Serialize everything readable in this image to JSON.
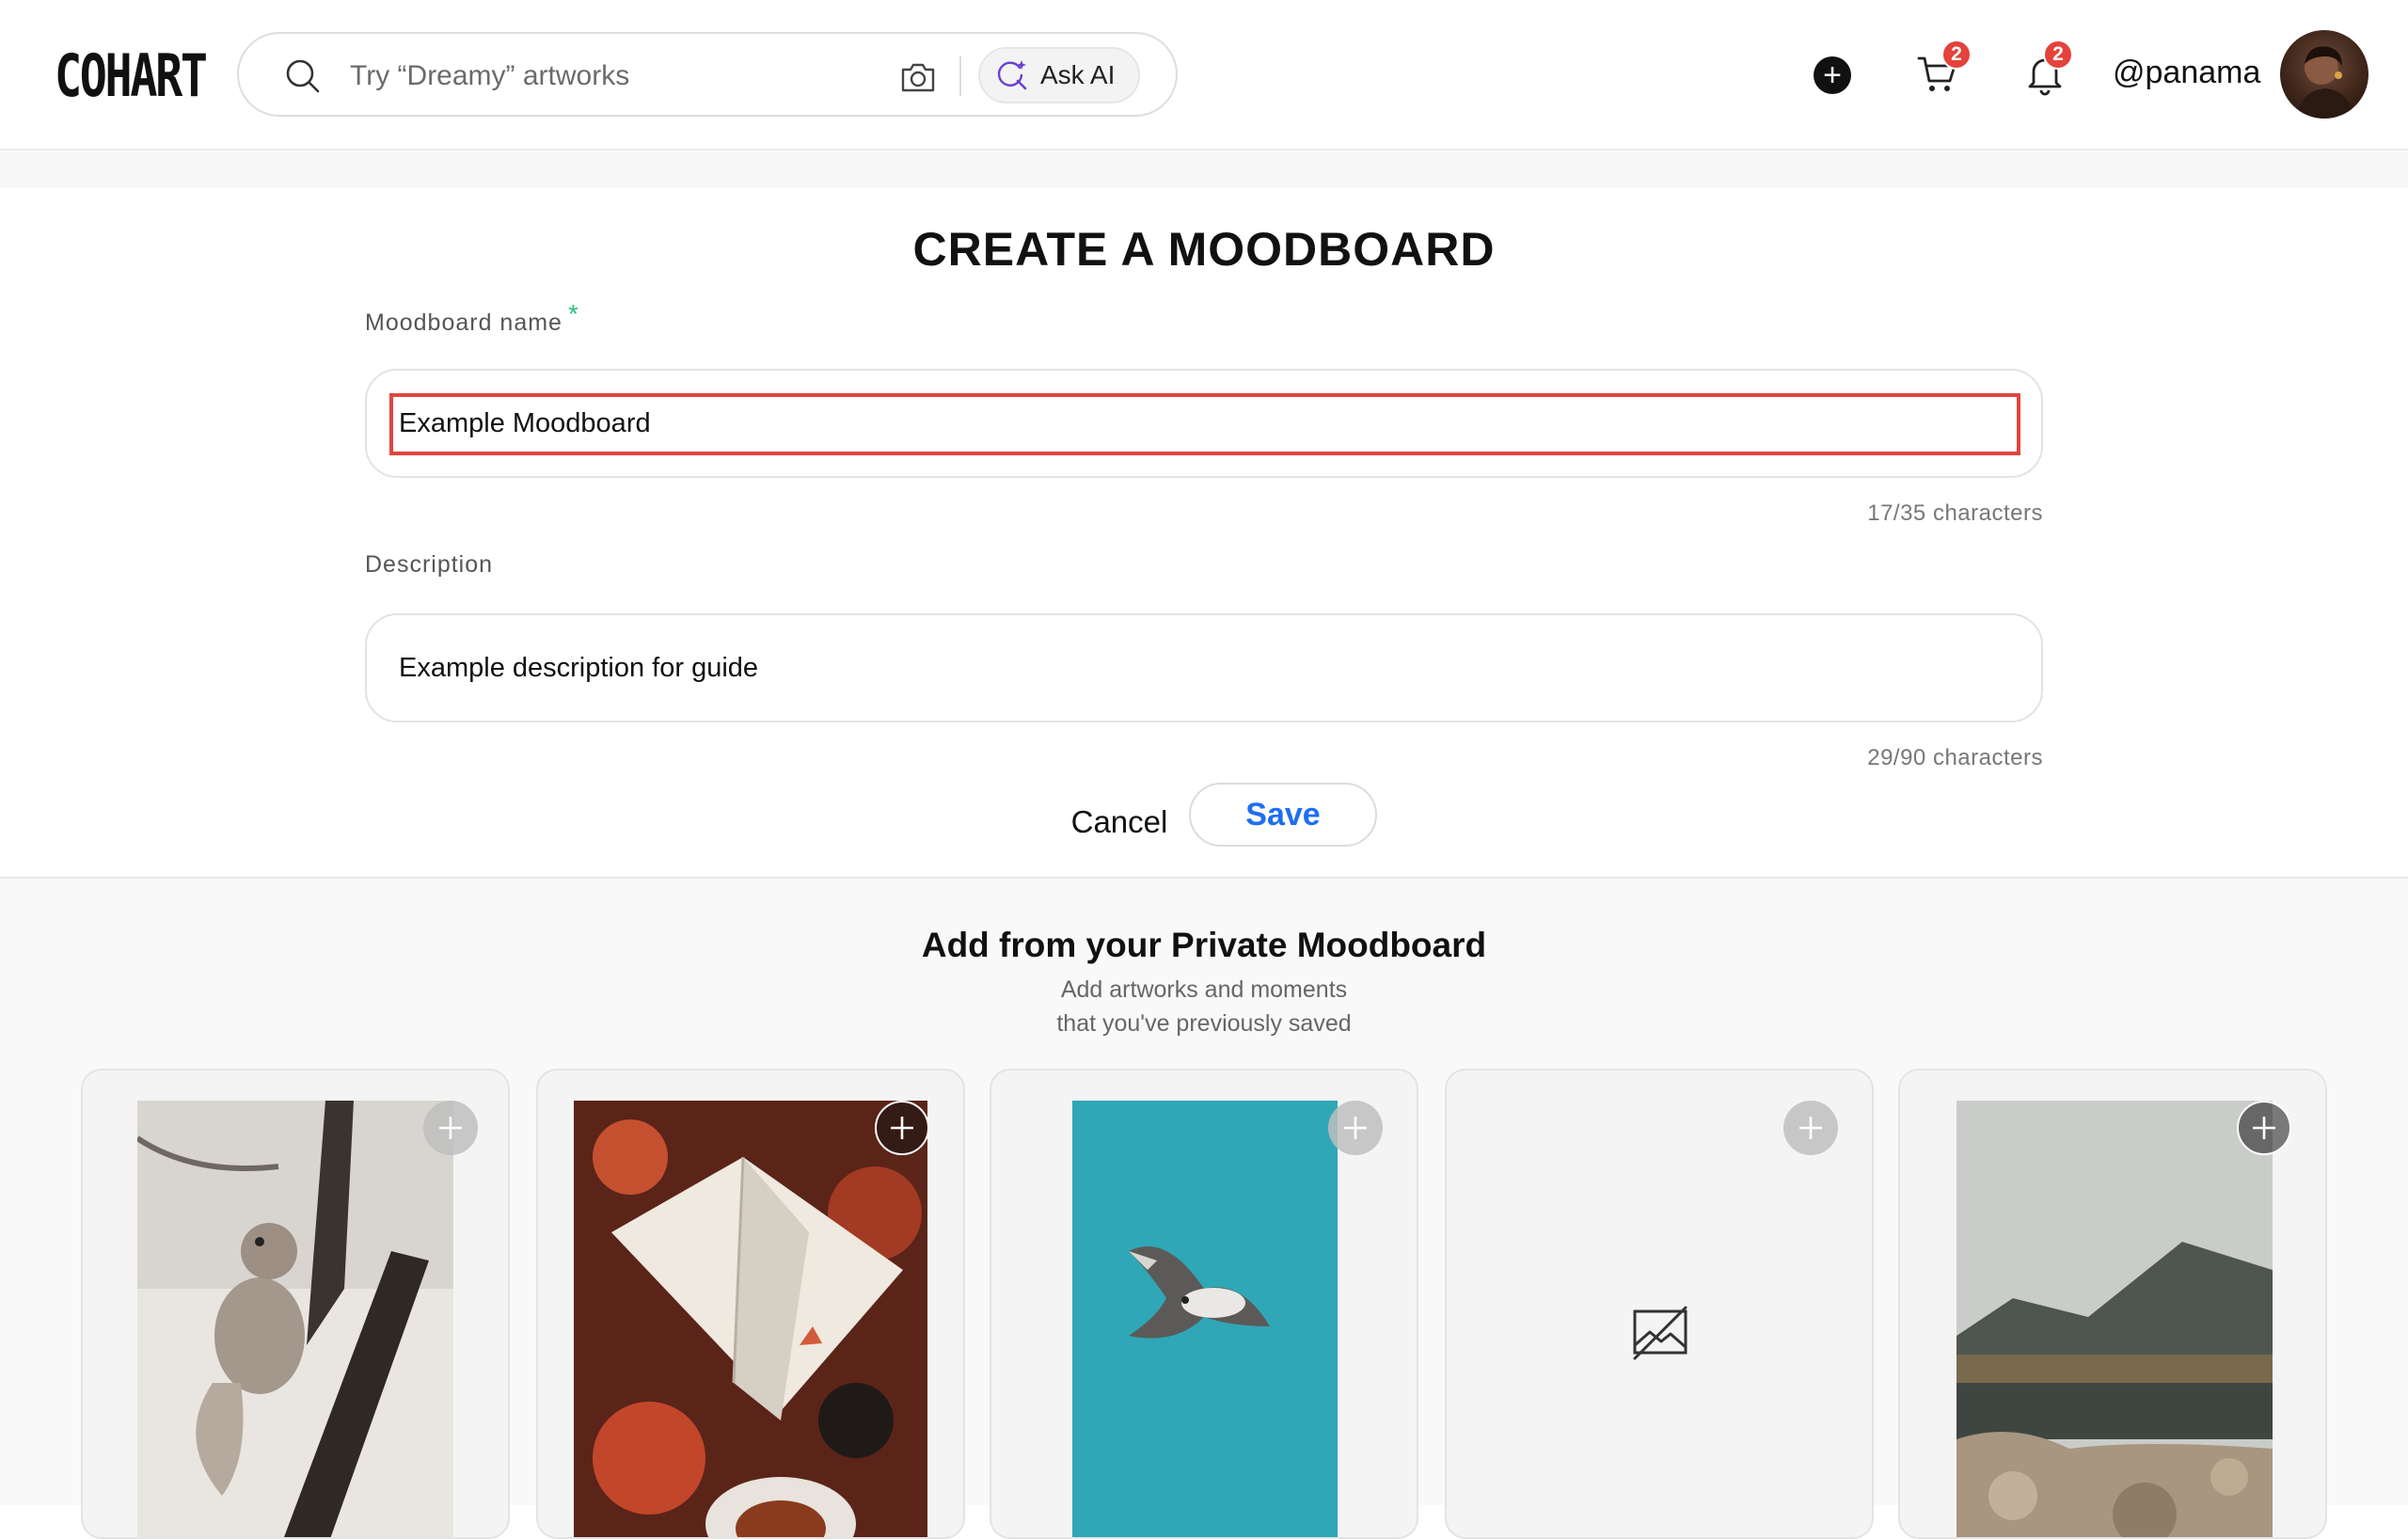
{
  "header": {
    "logo": "COHART",
    "search_placeholder": "Try “Dreamy” artworks",
    "ask_ai_label": "Ask AI",
    "cart_count": "2",
    "notification_count": "2",
    "username": "@panama"
  },
  "form": {
    "title": "CREATE A MOODBOARD",
    "name_label": "Moodboard name",
    "required_mark": "*",
    "name_value": "Example Moodboard",
    "name_counter": "17/35 characters",
    "description_label": "Description",
    "description_value": "Example description for guide",
    "description_counter": "29/90 characters",
    "cancel_label": "Cancel",
    "save_label": "Save"
  },
  "private_moodboard": {
    "title": "Add from your Private Moodboard",
    "subtitle_line1": "Add artworks and moments",
    "subtitle_line2": "that you've previously saved",
    "items": [
      {
        "subject": "squirrel-on-tree"
      },
      {
        "subject": "open-book-on-rug"
      },
      {
        "subject": "seagull-in-sky"
      },
      {
        "subject": "image-unavailable"
      },
      {
        "subject": "mountain-lake"
      }
    ]
  },
  "colors": {
    "accent": "#1e6ef0",
    "badge": "#e5423c",
    "required": "#23c483",
    "highlight": "#e0453f"
  }
}
